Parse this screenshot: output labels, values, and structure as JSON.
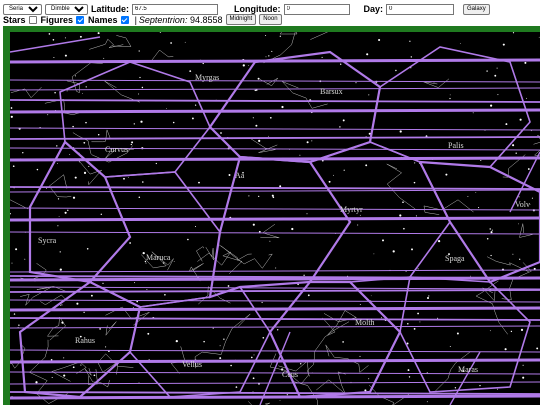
{
  "toolbar": {
    "world_select": "Seria",
    "place_select": "Dimble",
    "latitude_label": "Latitude:",
    "latitude_value": "67.5",
    "longitude_label": "Longitude:",
    "longitude_value": "0",
    "day_label": "Day:",
    "day_value": "0",
    "galaxy_button": "Galaxy"
  },
  "options": {
    "stars_label": "Stars",
    "stars_checked": false,
    "figures_label": "Figures",
    "figures_checked": true,
    "names_label": "Names",
    "names_checked": true,
    "separator": "|",
    "info_name": "Septentrion:",
    "info_value": "94.8558",
    "midnight_button": "Midnight",
    "noon_button": "Noon"
  },
  "sky": {
    "constellations": [
      "Myrgas",
      "Barsux",
      "Curvus",
      "Palis",
      "Aa",
      "Myrtyr",
      "Volv",
      "Sycra",
      "Maruca",
      "Spaga",
      "Molth",
      "Rahus",
      "Vellus",
      "Ceus",
      "Maras"
    ],
    "colors": {
      "background": "#000000",
      "frame": "#1f7a1f",
      "grid": "#b07ae8",
      "figures": "#bcbcbc",
      "stars": "#ffffff",
      "names": "#d8d8d8"
    }
  }
}
